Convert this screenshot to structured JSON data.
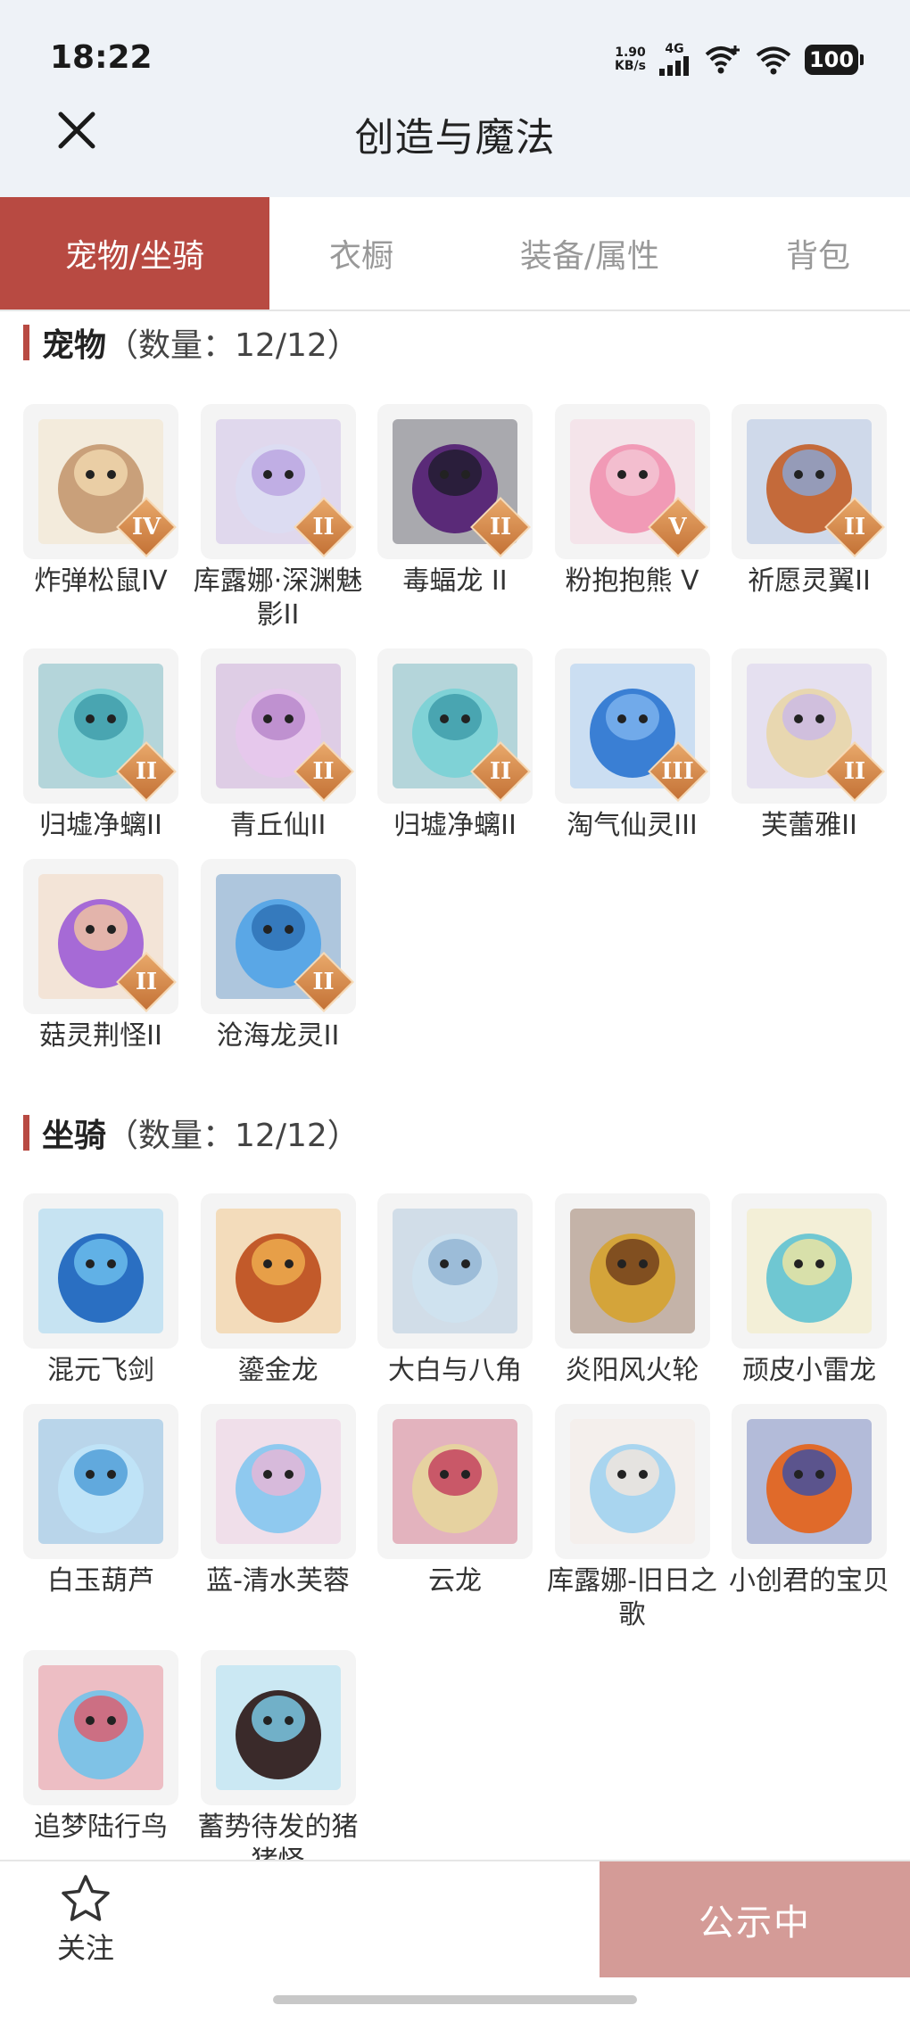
{
  "status_bar": {
    "time": "18:22",
    "net_speed_value": "1.90",
    "net_speed_unit": "KB/s",
    "network_type": "4G",
    "battery": "100"
  },
  "header": {
    "title": "创造与魔法",
    "close_icon": "close-icon"
  },
  "tabs": [
    {
      "label": "宠物/坐骑",
      "active": true
    },
    {
      "label": "衣橱",
      "active": false
    },
    {
      "label": "装备/属性",
      "active": false
    },
    {
      "label": "背包",
      "active": false
    }
  ],
  "pets": {
    "title": "宠物",
    "count": "（数量：12/12）",
    "items": [
      {
        "name": "炸弹松鼠IV",
        "rank": "IV"
      },
      {
        "name": "库露娜·深渊魅影II",
        "rank": "II"
      },
      {
        "name": "毒蝠龙 II",
        "rank": "II"
      },
      {
        "name": "粉抱抱熊 V",
        "rank": "V"
      },
      {
        "name": "祈愿灵翼II",
        "rank": "II"
      },
      {
        "name": "归墟净螭II",
        "rank": "II"
      },
      {
        "name": "青丘仙II",
        "rank": "II"
      },
      {
        "name": "归墟净螭II",
        "rank": "II"
      },
      {
        "name": "淘气仙灵III",
        "rank": "III"
      },
      {
        "name": "芙蕾雅II",
        "rank": "II"
      },
      {
        "name": "菇灵荆怪II",
        "rank": "II"
      },
      {
        "name": "沧海龙灵II",
        "rank": "II"
      }
    ]
  },
  "mounts": {
    "title": "坐骑",
    "count": "（数量：12/12）",
    "items": [
      {
        "name": "混元飞剑"
      },
      {
        "name": "鎏金龙"
      },
      {
        "name": "大白与八角"
      },
      {
        "name": "炎阳风火轮"
      },
      {
        "name": "顽皮小雷龙"
      },
      {
        "name": "白玉葫芦"
      },
      {
        "name": "蓝-清水芙蓉"
      },
      {
        "name": "云龙"
      },
      {
        "name": "库露娜-旧日之歌"
      },
      {
        "name": "小创君的宝贝"
      },
      {
        "name": "追梦陆行鸟"
      },
      {
        "name": "蓄势待发的猪猪怪"
      }
    ]
  },
  "bottom_bar": {
    "follow_label": "关注",
    "follow_icon": "star-outline-icon",
    "status_button": "公示中"
  },
  "colors": {
    "accent": "#b84a42",
    "status_button_bg": "#d49b97",
    "rank_badge": "#d88a4a"
  }
}
